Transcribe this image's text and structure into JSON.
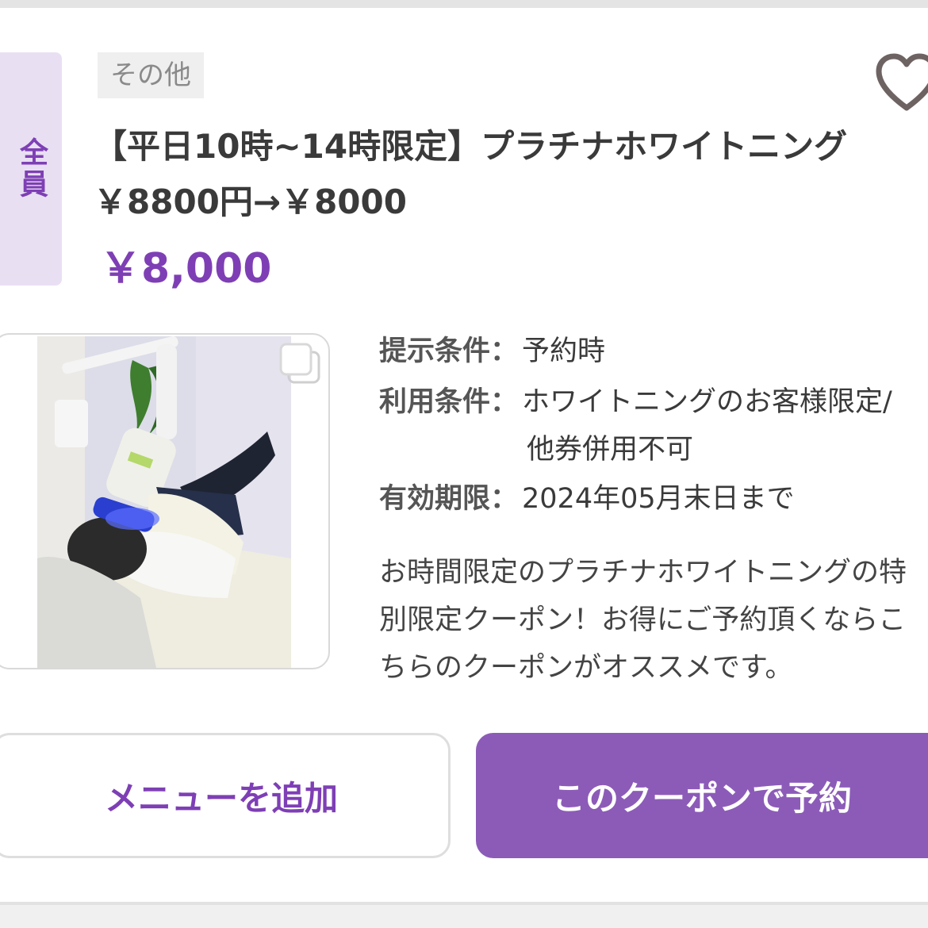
{
  "target_label": "全員",
  "category_tag": "その他",
  "title": "【平日10時~14時限定】プラチナホワイトニング￥8800円→￥8000",
  "price": "￥8,000",
  "conditions": [
    {
      "label": "提示条件",
      "colon": "：",
      "value": "予約時"
    },
    {
      "label": "利用条件",
      "colon": "：",
      "value": "ホワイトニングのお客様限定/",
      "value2": "他券併用不可"
    },
    {
      "label": "有効期限",
      "colon": "：",
      "value": "2024年05月末日まで"
    }
  ],
  "description": "お時間限定のプラチナホワイトニングの特別限定クーポン！お得にご予約頂くならこちらのクーポンがオススメです。",
  "buttons": {
    "add_menu": "メニューを追加",
    "reserve": "このクーポンで予約"
  },
  "icons": {
    "favorite": "heart-outline-icon",
    "gallery": "multiple-images-icon"
  },
  "colors": {
    "accent": "#7e3fb5",
    "reserve_button": "#8c5bb8",
    "ribbon_bg": "#e9dff3"
  }
}
